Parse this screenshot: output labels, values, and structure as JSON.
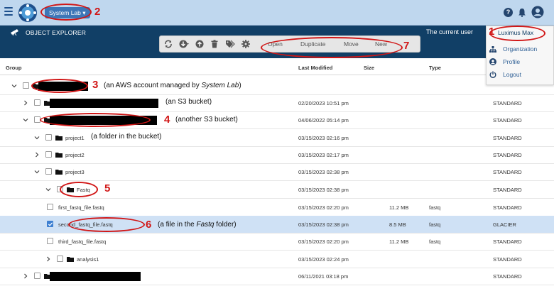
{
  "topbar": {
    "lab_label": "System Lab ▾",
    "help": "?"
  },
  "objbar": {
    "title": "OBJECT EXPLORER",
    "current_user": "The current user"
  },
  "toolbar": {
    "open": "Open",
    "duplicate": "Duplicate",
    "move": "Move",
    "new": "New"
  },
  "user_menu": {
    "name": "Luximus Max",
    "items": [
      "Organization",
      "Profile",
      "Logout"
    ]
  },
  "columns": {
    "group": "Group",
    "last_modified": "Last Modified",
    "size": "Size",
    "type": "Type"
  },
  "rows": [
    {
      "name": "",
      "modified": "",
      "size": "",
      "ftype": "",
      "storage": ""
    },
    {
      "name": "",
      "modified": "02/20/2023 10:51 pm",
      "size": "",
      "ftype": "",
      "storage": "STANDARD"
    },
    {
      "name": "",
      "modified": "04/06/2022 05:14 pm",
      "size": "",
      "ftype": "",
      "storage": "STANDARD"
    },
    {
      "name": "project1",
      "modified": "03/15/2023 02:16 pm",
      "size": "",
      "ftype": "",
      "storage": "STANDARD"
    },
    {
      "name": "project2",
      "modified": "03/15/2023 02:17 pm",
      "size": "",
      "ftype": "",
      "storage": "STANDARD"
    },
    {
      "name": "project3",
      "modified": "03/15/2023 02:38 pm",
      "size": "",
      "ftype": "",
      "storage": "STANDARD"
    },
    {
      "name": "Fastq",
      "modified": "03/15/2023 02:38 pm",
      "size": "",
      "ftype": "",
      "storage": "STANDARD"
    },
    {
      "name": "first_fastq_file.fastq",
      "modified": "03/15/2023 02:20 pm",
      "size": "11.2 MB",
      "ftype": "fastq",
      "storage": "STANDARD"
    },
    {
      "name": "second_fastq_file.fastq",
      "modified": "03/15/2023 02:38 pm",
      "size": "8.5 MB",
      "ftype": "fastq",
      "storage": "GLACIER"
    },
    {
      "name": "third_fastq_file.fastq",
      "modified": "03/15/2023 02:20 pm",
      "size": "11.2 MB",
      "ftype": "fastq",
      "storage": "STANDARD"
    },
    {
      "name": "analysis1",
      "modified": "03/15/2023 02:24 pm",
      "size": "",
      "ftype": "",
      "storage": "STANDARD"
    },
    {
      "name": "",
      "modified": "06/11/2021 03:18 pm",
      "size": "",
      "ftype": "",
      "storage": "STANDARD"
    }
  ],
  "annotations": {
    "n1": "1",
    "n2": "2",
    "n3": "3",
    "n4": "4",
    "n5": "5",
    "n6": "6",
    "n7": "7",
    "a3_pre": "(an AWS account managed by ",
    "a3_em": "System Lab",
    "a3_post": ")",
    "a_s3": "(an S3 bucket)",
    "a4": "(another S3 bucket)",
    "a_folder": "(a folder in the bucket)",
    "a6_pre": "(a file in the ",
    "a6_em": "Fastq",
    "a6_post": " folder)"
  },
  "colors": {
    "topbar": "#bfd7ee",
    "objbar": "#113f66",
    "selected_row": "#cfe1f5",
    "annotation": "#d11616"
  }
}
